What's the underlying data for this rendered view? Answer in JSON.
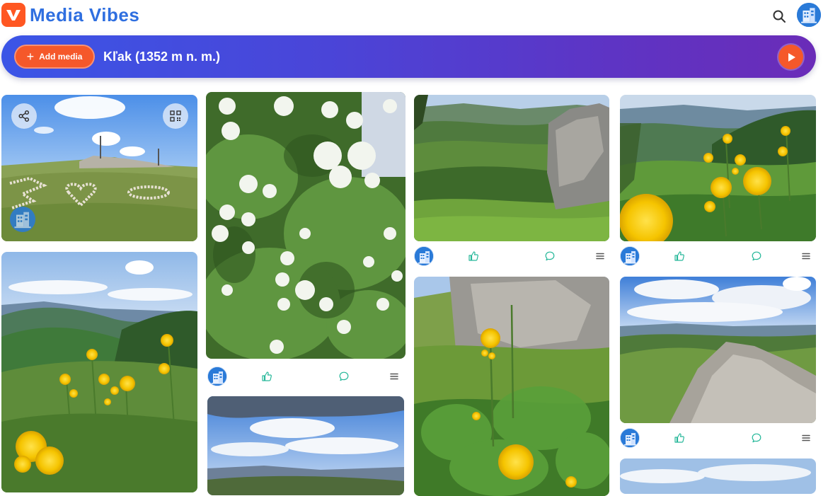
{
  "header": {
    "app_title": "Media Vibes",
    "logo_icon": "heart-v-icon",
    "search_icon": "search-icon",
    "profile_icon": "building-avatar-icon"
  },
  "banner": {
    "add_media_label": "Add media",
    "title": "Kľak (1352 m n. m.)",
    "play_icon": "play-icon"
  },
  "colors": {
    "brand_orange": "#f5582a",
    "brand_blue": "#2f6fe0",
    "banner_start": "#3b55e6",
    "banner_end": "#6a2cb8",
    "action_icon": "#27b89a"
  },
  "media_items": [
    {
      "subject": "heart shaped stones on grassy summit",
      "column": 1,
      "has_overlay_buttons": true
    },
    {
      "subject": "white snowball viburnum blossoms",
      "column": 2
    },
    {
      "subject": "green mountain valley with rock outcrop",
      "column": 3
    },
    {
      "subject": "yellow globeflowers over mountain ridge",
      "column": 4
    },
    {
      "subject": "globeflowers on hillside with valley view",
      "column": 1
    },
    {
      "subject": "cloudy sky over distant hills",
      "column": 2
    },
    {
      "subject": "yellow globeflowers by limestone rock",
      "column": 3
    },
    {
      "subject": "rocky ridge under cumulus clouds",
      "column": 4
    },
    {
      "subject": "sky with clouds",
      "column": 4
    }
  ]
}
